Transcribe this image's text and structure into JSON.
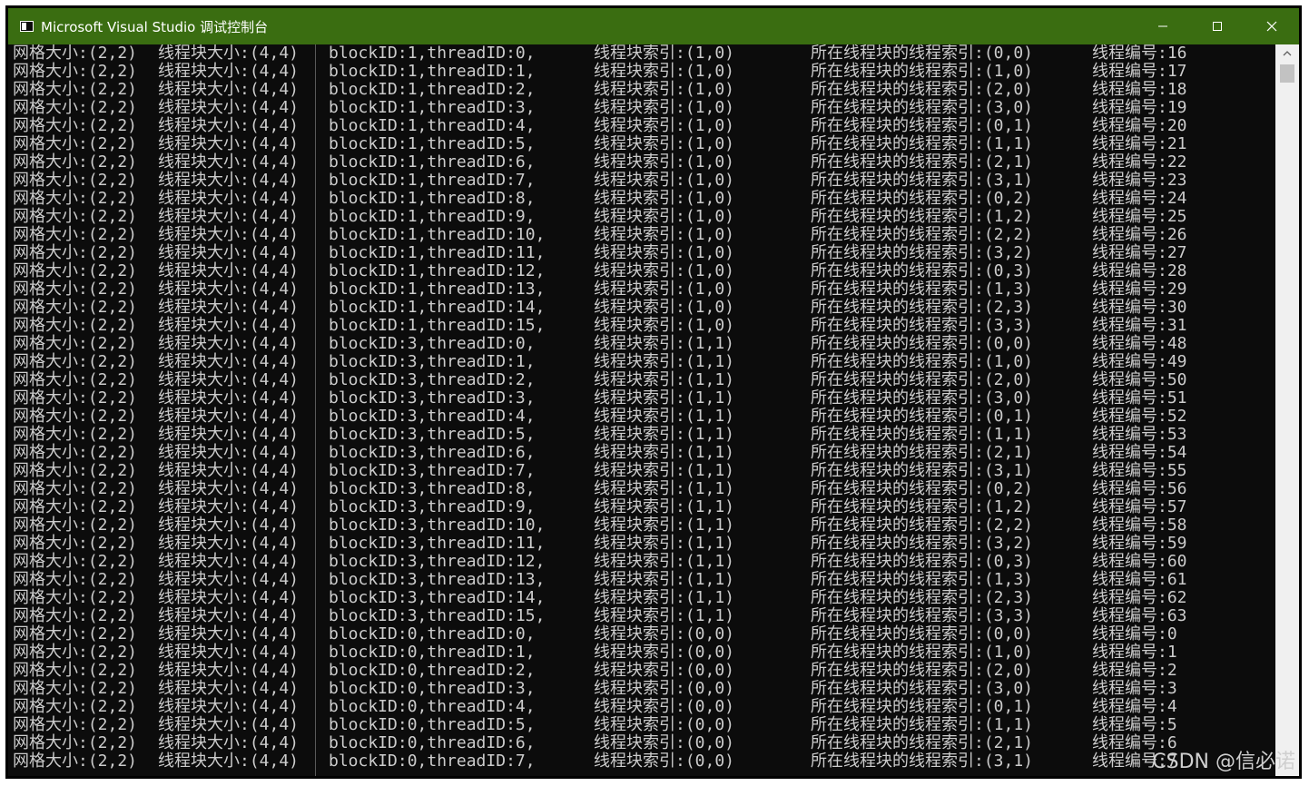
{
  "window": {
    "title": "Microsoft Visual Studio 调试控制台"
  },
  "icons": {
    "app": "console-app-icon",
    "minimize": "minimize-icon",
    "maximize": "maximize-icon",
    "close": "close-icon",
    "scroll_up": "chevron-up-icon"
  },
  "colors": {
    "titlebar": "#3a6d11",
    "console_bg": "#0c0c0c",
    "console_text": "#cccccc"
  },
  "console": {
    "lines": [
      [
        "网格大小:(2,2)",
        "线程块大小:(4,4)",
        "blockID:1,threadID:0,",
        "线程块索引:(1,0)",
        "所在线程块的线程索引:(0,0)",
        "线程编号:16"
      ],
      [
        "网格大小:(2,2)",
        "线程块大小:(4,4)",
        "blockID:1,threadID:1,",
        "线程块索引:(1,0)",
        "所在线程块的线程索引:(1,0)",
        "线程编号:17"
      ],
      [
        "网格大小:(2,2)",
        "线程块大小:(4,4)",
        "blockID:1,threadID:2,",
        "线程块索引:(1,0)",
        "所在线程块的线程索引:(2,0)",
        "线程编号:18"
      ],
      [
        "网格大小:(2,2)",
        "线程块大小:(4,4)",
        "blockID:1,threadID:3,",
        "线程块索引:(1,0)",
        "所在线程块的线程索引:(3,0)",
        "线程编号:19"
      ],
      [
        "网格大小:(2,2)",
        "线程块大小:(4,4)",
        "blockID:1,threadID:4,",
        "线程块索引:(1,0)",
        "所在线程块的线程索引:(0,1)",
        "线程编号:20"
      ],
      [
        "网格大小:(2,2)",
        "线程块大小:(4,4)",
        "blockID:1,threadID:5,",
        "线程块索引:(1,0)",
        "所在线程块的线程索引:(1,1)",
        "线程编号:21"
      ],
      [
        "网格大小:(2,2)",
        "线程块大小:(4,4)",
        "blockID:1,threadID:6,",
        "线程块索引:(1,0)",
        "所在线程块的线程索引:(2,1)",
        "线程编号:22"
      ],
      [
        "网格大小:(2,2)",
        "线程块大小:(4,4)",
        "blockID:1,threadID:7,",
        "线程块索引:(1,0)",
        "所在线程块的线程索引:(3,1)",
        "线程编号:23"
      ],
      [
        "网格大小:(2,2)",
        "线程块大小:(4,4)",
        "blockID:1,threadID:8,",
        "线程块索引:(1,0)",
        "所在线程块的线程索引:(0,2)",
        "线程编号:24"
      ],
      [
        "网格大小:(2,2)",
        "线程块大小:(4,4)",
        "blockID:1,threadID:9,",
        "线程块索引:(1,0)",
        "所在线程块的线程索引:(1,2)",
        "线程编号:25"
      ],
      [
        "网格大小:(2,2)",
        "线程块大小:(4,4)",
        "blockID:1,threadID:10,",
        "线程块索引:(1,0)",
        "所在线程块的线程索引:(2,2)",
        "线程编号:26"
      ],
      [
        "网格大小:(2,2)",
        "线程块大小:(4,4)",
        "blockID:1,threadID:11,",
        "线程块索引:(1,0)",
        "所在线程块的线程索引:(3,2)",
        "线程编号:27"
      ],
      [
        "网格大小:(2,2)",
        "线程块大小:(4,4)",
        "blockID:1,threadID:12,",
        "线程块索引:(1,0)",
        "所在线程块的线程索引:(0,3)",
        "线程编号:28"
      ],
      [
        "网格大小:(2,2)",
        "线程块大小:(4,4)",
        "blockID:1,threadID:13,",
        "线程块索引:(1,0)",
        "所在线程块的线程索引:(1,3)",
        "线程编号:29"
      ],
      [
        "网格大小:(2,2)",
        "线程块大小:(4,4)",
        "blockID:1,threadID:14,",
        "线程块索引:(1,0)",
        "所在线程块的线程索引:(2,3)",
        "线程编号:30"
      ],
      [
        "网格大小:(2,2)",
        "线程块大小:(4,4)",
        "blockID:1,threadID:15,",
        "线程块索引:(1,0)",
        "所在线程块的线程索引:(3,3)",
        "线程编号:31"
      ],
      [
        "网格大小:(2,2)",
        "线程块大小:(4,4)",
        "blockID:3,threadID:0,",
        "线程块索引:(1,1)",
        "所在线程块的线程索引:(0,0)",
        "线程编号:48"
      ],
      [
        "网格大小:(2,2)",
        "线程块大小:(4,4)",
        "blockID:3,threadID:1,",
        "线程块索引:(1,1)",
        "所在线程块的线程索引:(1,0)",
        "线程编号:49"
      ],
      [
        "网格大小:(2,2)",
        "线程块大小:(4,4)",
        "blockID:3,threadID:2,",
        "线程块索引:(1,1)",
        "所在线程块的线程索引:(2,0)",
        "线程编号:50"
      ],
      [
        "网格大小:(2,2)",
        "线程块大小:(4,4)",
        "blockID:3,threadID:3,",
        "线程块索引:(1,1)",
        "所在线程块的线程索引:(3,0)",
        "线程编号:51"
      ],
      [
        "网格大小:(2,2)",
        "线程块大小:(4,4)",
        "blockID:3,threadID:4,",
        "线程块索引:(1,1)",
        "所在线程块的线程索引:(0,1)",
        "线程编号:52"
      ],
      [
        "网格大小:(2,2)",
        "线程块大小:(4,4)",
        "blockID:3,threadID:5,",
        "线程块索引:(1,1)",
        "所在线程块的线程索引:(1,1)",
        "线程编号:53"
      ],
      [
        "网格大小:(2,2)",
        "线程块大小:(4,4)",
        "blockID:3,threadID:6,",
        "线程块索引:(1,1)",
        "所在线程块的线程索引:(2,1)",
        "线程编号:54"
      ],
      [
        "网格大小:(2,2)",
        "线程块大小:(4,4)",
        "blockID:3,threadID:7,",
        "线程块索引:(1,1)",
        "所在线程块的线程索引:(3,1)",
        "线程编号:55"
      ],
      [
        "网格大小:(2,2)",
        "线程块大小:(4,4)",
        "blockID:3,threadID:8,",
        "线程块索引:(1,1)",
        "所在线程块的线程索引:(0,2)",
        "线程编号:56"
      ],
      [
        "网格大小:(2,2)",
        "线程块大小:(4,4)",
        "blockID:3,threadID:9,",
        "线程块索引:(1,1)",
        "所在线程块的线程索引:(1,2)",
        "线程编号:57"
      ],
      [
        "网格大小:(2,2)",
        "线程块大小:(4,4)",
        "blockID:3,threadID:10,",
        "线程块索引:(1,1)",
        "所在线程块的线程索引:(2,2)",
        "线程编号:58"
      ],
      [
        "网格大小:(2,2)",
        "线程块大小:(4,4)",
        "blockID:3,threadID:11,",
        "线程块索引:(1,1)",
        "所在线程块的线程索引:(3,2)",
        "线程编号:59"
      ],
      [
        "网格大小:(2,2)",
        "线程块大小:(4,4)",
        "blockID:3,threadID:12,",
        "线程块索引:(1,1)",
        "所在线程块的线程索引:(0,3)",
        "线程编号:60"
      ],
      [
        "网格大小:(2,2)",
        "线程块大小:(4,4)",
        "blockID:3,threadID:13,",
        "线程块索引:(1,1)",
        "所在线程块的线程索引:(1,3)",
        "线程编号:61"
      ],
      [
        "网格大小:(2,2)",
        "线程块大小:(4,4)",
        "blockID:3,threadID:14,",
        "线程块索引:(1,1)",
        "所在线程块的线程索引:(2,3)",
        "线程编号:62"
      ],
      [
        "网格大小:(2,2)",
        "线程块大小:(4,4)",
        "blockID:3,threadID:15,",
        "线程块索引:(1,1)",
        "所在线程块的线程索引:(3,3)",
        "线程编号:63"
      ],
      [
        "网格大小:(2,2)",
        "线程块大小:(4,4)",
        "blockID:0,threadID:0,",
        "线程块索引:(0,0)",
        "所在线程块的线程索引:(0,0)",
        "线程编号:0"
      ],
      [
        "网格大小:(2,2)",
        "线程块大小:(4,4)",
        "blockID:0,threadID:1,",
        "线程块索引:(0,0)",
        "所在线程块的线程索引:(1,0)",
        "线程编号:1"
      ],
      [
        "网格大小:(2,2)",
        "线程块大小:(4,4)",
        "blockID:0,threadID:2,",
        "线程块索引:(0,0)",
        "所在线程块的线程索引:(2,0)",
        "线程编号:2"
      ],
      [
        "网格大小:(2,2)",
        "线程块大小:(4,4)",
        "blockID:0,threadID:3,",
        "线程块索引:(0,0)",
        "所在线程块的线程索引:(3,0)",
        "线程编号:3"
      ],
      [
        "网格大小:(2,2)",
        "线程块大小:(4,4)",
        "blockID:0,threadID:4,",
        "线程块索引:(0,0)",
        "所在线程块的线程索引:(0,1)",
        "线程编号:4"
      ],
      [
        "网格大小:(2,2)",
        "线程块大小:(4,4)",
        "blockID:0,threadID:5,",
        "线程块索引:(0,0)",
        "所在线程块的线程索引:(1,1)",
        "线程编号:5"
      ],
      [
        "网格大小:(2,2)",
        "线程块大小:(4,4)",
        "blockID:0,threadID:6,",
        "线程块索引:(0,0)",
        "所在线程块的线程索引:(2,1)",
        "线程编号:6"
      ],
      [
        "网格大小:(2,2)",
        "线程块大小:(4,4)",
        "blockID:0,threadID:7,",
        "线程块索引:(0,0)",
        "所在线程块的线程索引:(3,1)",
        "线程编号:7"
      ]
    ]
  },
  "watermark": "CSDN @信必诺"
}
